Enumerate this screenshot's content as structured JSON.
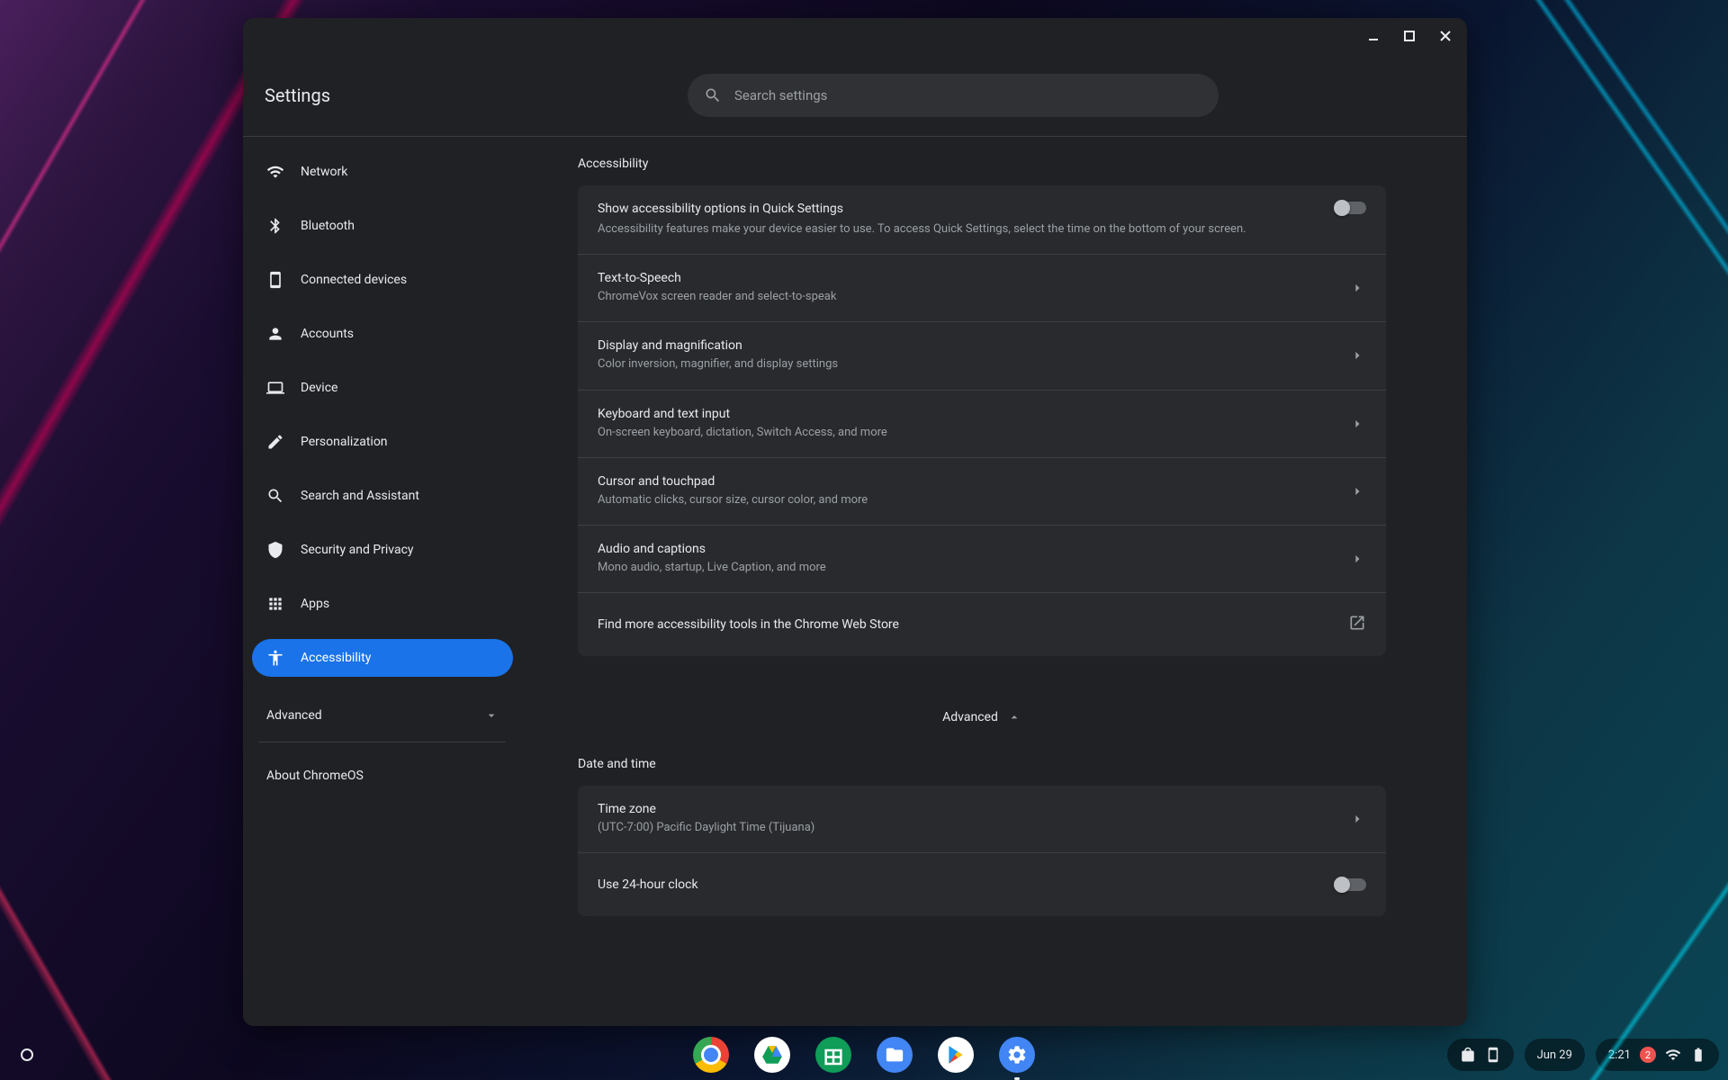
{
  "app": {
    "title": "Settings"
  },
  "search": {
    "placeholder": "Search settings"
  },
  "sidebar": {
    "items": [
      {
        "label": "Network"
      },
      {
        "label": "Bluetooth"
      },
      {
        "label": "Connected devices"
      },
      {
        "label": "Accounts"
      },
      {
        "label": "Device"
      },
      {
        "label": "Personalization"
      },
      {
        "label": "Search and Assistant"
      },
      {
        "label": "Security and Privacy"
      },
      {
        "label": "Apps"
      },
      {
        "label": "Accessibility"
      }
    ],
    "advanced_label": "Advanced",
    "about_label": "About ChromeOS"
  },
  "main": {
    "section_accessibility_title": "Accessibility",
    "quick_settings": {
      "title": "Show accessibility options in Quick Settings",
      "sub": "Accessibility features make your device easier to use. To access Quick Settings, select the time on the bottom of your screen.",
      "enabled": false
    },
    "rows": [
      {
        "title": "Text-to-Speech",
        "sub": "ChromeVox screen reader and select-to-speak"
      },
      {
        "title": "Display and magnification",
        "sub": "Color inversion, magnifier, and display settings"
      },
      {
        "title": "Keyboard and text input",
        "sub": "On-screen keyboard, dictation, Switch Access, and more"
      },
      {
        "title": "Cursor and touchpad",
        "sub": "Automatic clicks, cursor size, cursor color, and more"
      },
      {
        "title": "Audio and captions",
        "sub": "Mono audio, startup, Live Caption, and more"
      }
    ],
    "webstore_row": "Find more accessibility tools in the Chrome Web Store",
    "advanced_label": "Advanced",
    "section_datetime_title": "Date and time",
    "timezone": {
      "title": "Time zone",
      "value": "(UTC-7:00) Pacific Daylight Time (Tijuana)"
    },
    "clock24": {
      "title": "Use 24-hour clock",
      "enabled": false
    }
  },
  "shelf": {
    "date": "Jun 29",
    "time": "2:21",
    "notification_count": "2"
  }
}
